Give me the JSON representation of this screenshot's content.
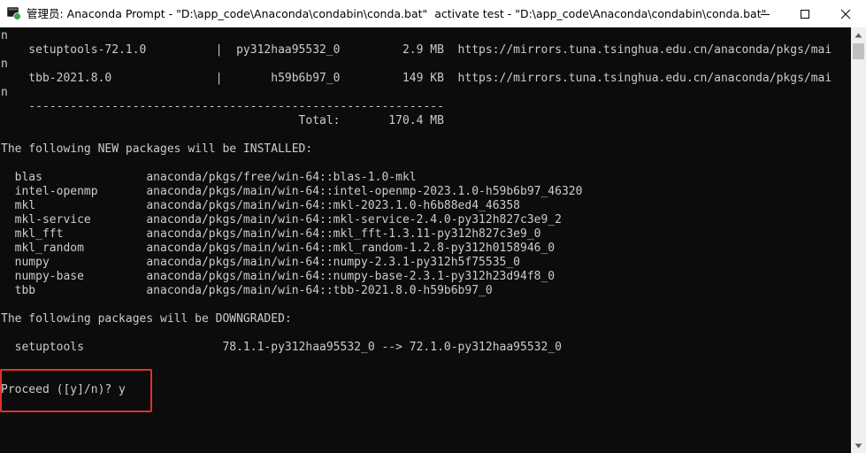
{
  "window": {
    "title": "管理员: Anaconda Prompt - \"D:\\app_code\\Anaconda\\condabin\\conda.bat\"  activate test - \"D:\\app_code\\Anaconda\\condabin\\conda.bat\"",
    "icon": "terminal-app-icon",
    "controls": [
      "minimize-icon",
      "maximize-icon",
      "close-icon"
    ]
  },
  "colors": {
    "console_bg": "#0c0c0c",
    "console_text": "#cccccc",
    "highlight_border": "#e0312f"
  },
  "console": {
    "lines": [
      "n",
      "    setuptools-72.1.0          |  py312haa95532_0         2.9 MB  https://mirrors.tuna.tsinghua.edu.cn/anaconda/pkgs/mai",
      "n",
      "    tbb-2021.8.0               |       h59b6b97_0         149 KB  https://mirrors.tuna.tsinghua.edu.cn/anaconda/pkgs/mai",
      "n",
      "    ------------------------------------------------------------",
      "                                           Total:       170.4 MB",
      "",
      "The following NEW packages will be INSTALLED:",
      "",
      "  blas               anaconda/pkgs/free/win-64::blas-1.0-mkl",
      "  intel-openmp       anaconda/pkgs/main/win-64::intel-openmp-2023.1.0-h59b6b97_46320",
      "  mkl                anaconda/pkgs/main/win-64::mkl-2023.1.0-h6b88ed4_46358",
      "  mkl-service        anaconda/pkgs/main/win-64::mkl-service-2.4.0-py312h827c3e9_2",
      "  mkl_fft            anaconda/pkgs/main/win-64::mkl_fft-1.3.11-py312h827c3e9_0",
      "  mkl_random         anaconda/pkgs/main/win-64::mkl_random-1.2.8-py312h0158946_0",
      "  numpy              anaconda/pkgs/main/win-64::numpy-2.3.1-py312h5f75535_0",
      "  numpy-base         anaconda/pkgs/main/win-64::numpy-base-2.3.1-py312h23d94f8_0",
      "  tbb                anaconda/pkgs/main/win-64::tbb-2021.8.0-h59b6b97_0",
      "",
      "The following packages will be DOWNGRADED:",
      "",
      "  setuptools                    78.1.1-py312haa95532_0 --> 72.1.0-py312haa95532_0",
      "",
      "",
      "Proceed ([y]/n)? y"
    ]
  }
}
